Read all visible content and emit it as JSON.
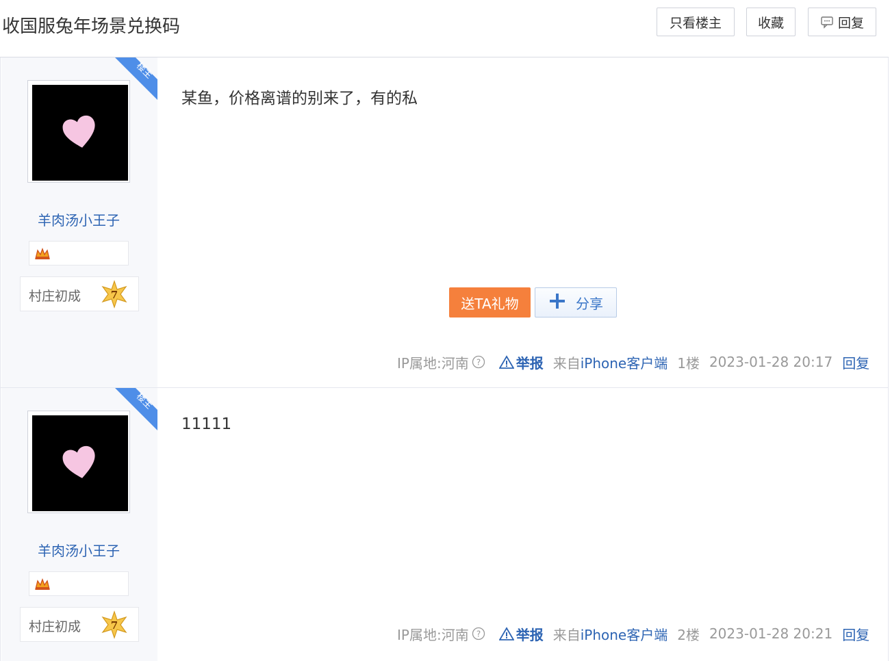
{
  "thread": {
    "title": "收国服兔年场景兑换码",
    "buttons": {
      "only_op": "只看楼主",
      "favorite": "收藏",
      "reply": "回复"
    }
  },
  "posts": [
    {
      "ribbon": "楼主",
      "username": "羊肉汤小王子",
      "level_title": "村庄初成",
      "level": "7",
      "content": "某鱼，价格离谱的别来了，有的私",
      "gift_label": "送TA礼物",
      "share_label": "分享",
      "ip": "IP属地:河南",
      "report": "举报",
      "from_prefix": "来自",
      "from_client": "iPhone客户端",
      "floor": "1楼",
      "time": "2023-01-28 20:17",
      "reply": "回复"
    },
    {
      "ribbon": "楼主",
      "username": "羊肉汤小王子",
      "level_title": "村庄初成",
      "level": "7",
      "content": "11111",
      "ip": "IP属地:河南",
      "report": "举报",
      "from_prefix": "来自",
      "from_client": "iPhone客户端",
      "floor": "2楼",
      "time": "2023-01-28 20:21",
      "reply": "回复"
    }
  ],
  "colors": {
    "link": "#2d64b3",
    "gift": "#f5803c",
    "ribbon": "#4e8ee8"
  }
}
